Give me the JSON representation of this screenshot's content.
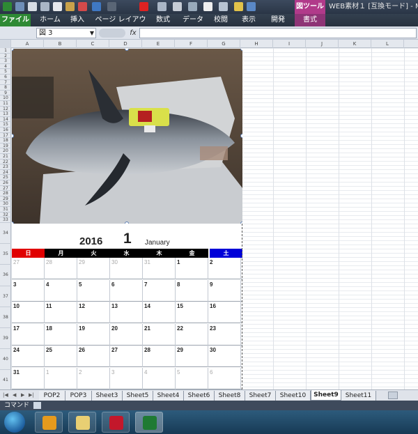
{
  "qat": {
    "picture_tools": "図ツール",
    "title": "WEB素材１ [互換モード] - Mi"
  },
  "tabs": [
    {
      "label": "ファイル"
    },
    {
      "label": "ホーム"
    },
    {
      "label": "挿入"
    },
    {
      "label": "ページ レイアウト"
    },
    {
      "label": "数式"
    },
    {
      "label": "データ"
    },
    {
      "label": "校閲"
    },
    {
      "label": "表示"
    },
    {
      "label": "開発"
    },
    {
      "label": "書式"
    }
  ],
  "formula_bar": {
    "name_box": "図 3",
    "fx": "fx",
    "formula": ""
  },
  "columns": [
    "A",
    "B",
    "C",
    "D",
    "E",
    "F",
    "G",
    "H",
    "I",
    "J",
    "K",
    "L"
  ],
  "rows": [
    "1",
    "2",
    "3",
    "4",
    "5",
    "6",
    "7",
    "8",
    "9",
    "10",
    "11",
    "12",
    "13",
    "14",
    "15",
    "16",
    "17",
    "18",
    "19",
    "20",
    "21",
    "22",
    "23",
    "24",
    "25",
    "26",
    "27",
    "28",
    "29",
    "30",
    "31",
    "32",
    "33",
    "34",
    "35",
    "36",
    "37",
    "38",
    "39",
    "40",
    "41"
  ],
  "calendar": {
    "year": "2016",
    "month": "1",
    "month_name": "January",
    "weekdays": [
      "日",
      "月",
      "火",
      "水",
      "木",
      "金",
      "土"
    ],
    "weeks": [
      [
        {
          "d": "27",
          "other": true
        },
        {
          "d": "28",
          "other": true
        },
        {
          "d": "29",
          "other": true
        },
        {
          "d": "30",
          "other": true
        },
        {
          "d": "31",
          "other": true
        },
        {
          "d": "1",
          "other": false
        },
        {
          "d": "2",
          "other": false
        }
      ],
      [
        {
          "d": "3",
          "other": false
        },
        {
          "d": "4",
          "other": false
        },
        {
          "d": "5",
          "other": false
        },
        {
          "d": "6",
          "other": false
        },
        {
          "d": "7",
          "other": false
        },
        {
          "d": "8",
          "other": false
        },
        {
          "d": "9",
          "other": false
        }
      ],
      [
        {
          "d": "10",
          "other": false
        },
        {
          "d": "11",
          "other": false
        },
        {
          "d": "12",
          "other": false
        },
        {
          "d": "13",
          "other": false
        },
        {
          "d": "14",
          "other": false
        },
        {
          "d": "15",
          "other": false
        },
        {
          "d": "16",
          "other": false
        }
      ],
      [
        {
          "d": "17",
          "other": false
        },
        {
          "d": "18",
          "other": false
        },
        {
          "d": "19",
          "other": false
        },
        {
          "d": "20",
          "other": false
        },
        {
          "d": "21",
          "other": false
        },
        {
          "d": "22",
          "other": false
        },
        {
          "d": "23",
          "other": false
        }
      ],
      [
        {
          "d": "24",
          "other": false
        },
        {
          "d": "25",
          "other": false
        },
        {
          "d": "26",
          "other": false
        },
        {
          "d": "27",
          "other": false
        },
        {
          "d": "28",
          "other": false
        },
        {
          "d": "29",
          "other": false
        },
        {
          "d": "30",
          "other": false
        }
      ],
      [
        {
          "d": "31",
          "other": false
        },
        {
          "d": "1",
          "other": true
        },
        {
          "d": "2",
          "other": true
        },
        {
          "d": "3",
          "other": true
        },
        {
          "d": "4",
          "other": true
        },
        {
          "d": "5",
          "other": true
        },
        {
          "d": "6",
          "other": true
        }
      ]
    ]
  },
  "sheet_tabs": [
    {
      "label": "POP2",
      "active": false
    },
    {
      "label": "POP3",
      "active": false
    },
    {
      "label": "Sheet3",
      "active": false
    },
    {
      "label": "Sheet5",
      "active": false
    },
    {
      "label": "Sheet4",
      "active": false
    },
    {
      "label": "Sheet6",
      "active": false
    },
    {
      "label": "Sheet8",
      "active": false
    },
    {
      "label": "Sheet7",
      "active": false
    },
    {
      "label": "Sheet10",
      "active": false
    },
    {
      "label": "Sheet9",
      "active": true
    },
    {
      "label": "Sheet11",
      "active": false
    }
  ],
  "status": {
    "mode": "コマンド"
  },
  "colors": {
    "file_tab": "#2e8a34",
    "picture_tools": "#b13a8a",
    "sunday": "#e00000",
    "saturday": "#0000d8"
  },
  "taskbar": {
    "apps": [
      "outlook-icon",
      "explorer-icon",
      "app-icon",
      "excel-icon"
    ]
  }
}
